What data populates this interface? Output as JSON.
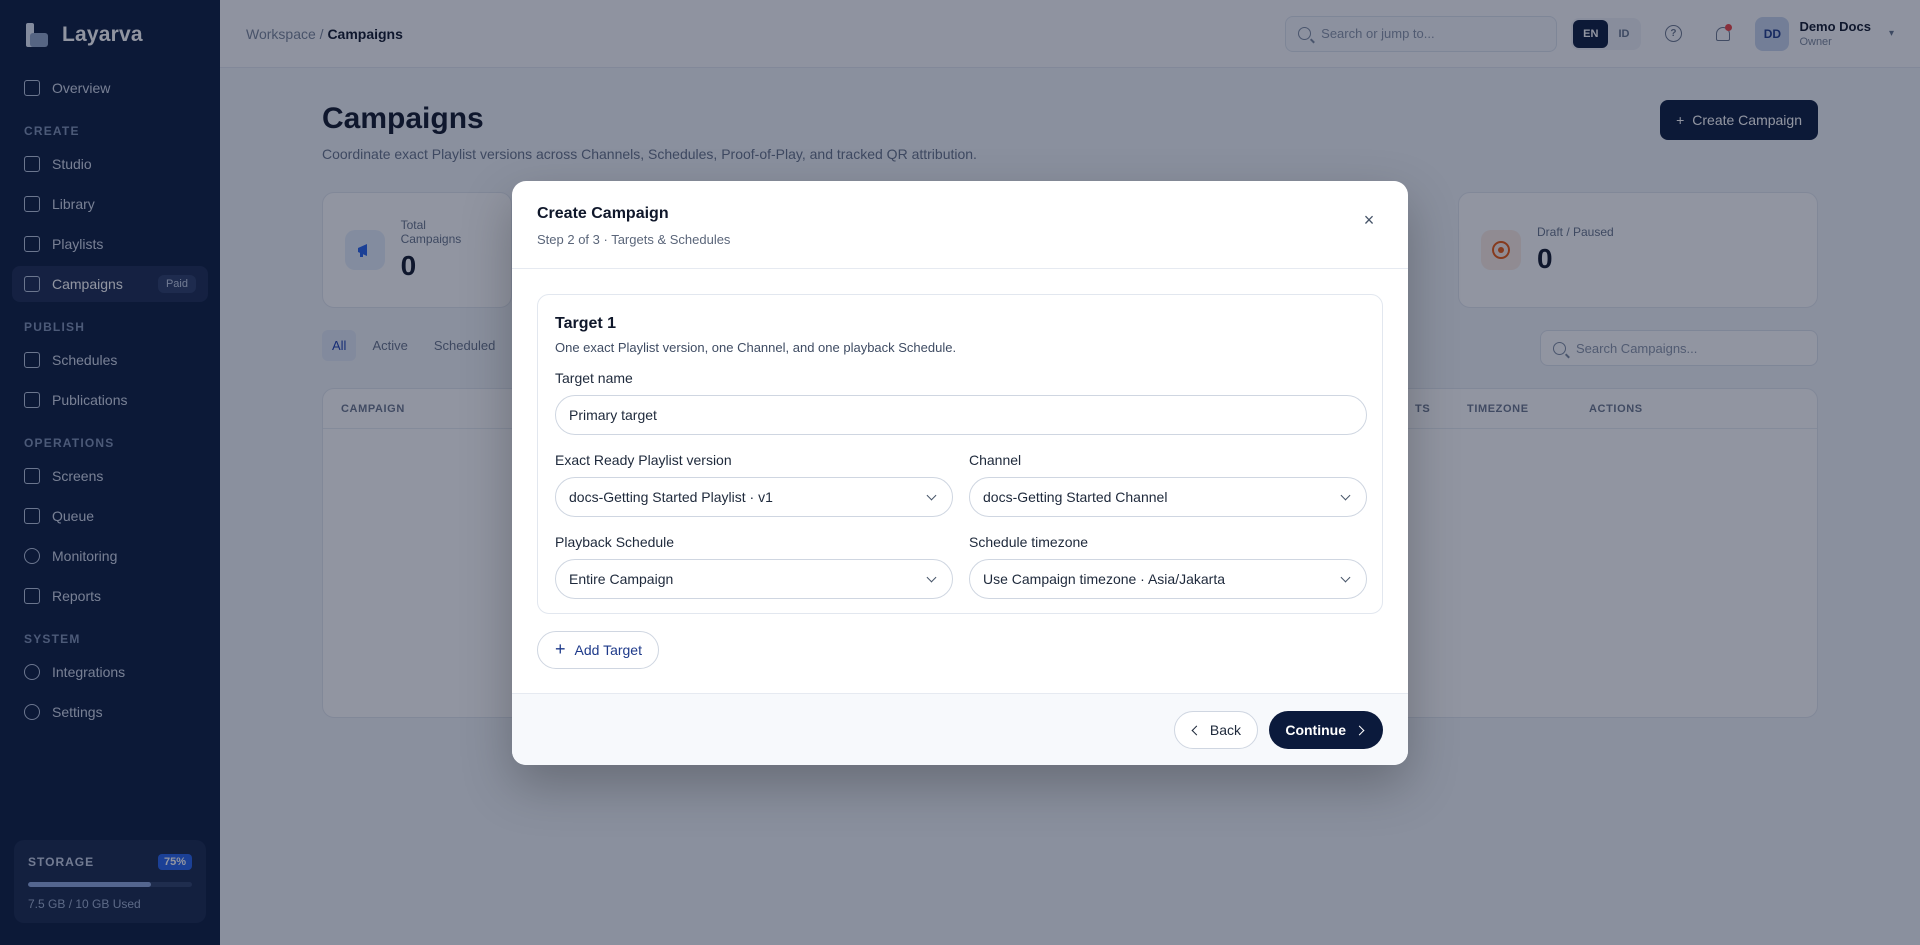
{
  "app": {
    "name": "Layarva"
  },
  "sidebar": {
    "top_item": {
      "label": "Overview",
      "icon": "grid-icon"
    },
    "sections": [
      {
        "title": "CREATE",
        "items": [
          {
            "label": "Studio",
            "icon": "monitor-icon"
          },
          {
            "label": "Library",
            "icon": "folder-icon"
          },
          {
            "label": "Playlists",
            "icon": "list-icon"
          },
          {
            "label": "Campaigns",
            "icon": "megaphone-icon",
            "badge": "Paid",
            "active": true
          }
        ]
      },
      {
        "title": "PUBLISH",
        "items": [
          {
            "label": "Schedules",
            "icon": "calendar-icon"
          },
          {
            "label": "Publications",
            "icon": "send-icon"
          }
        ]
      },
      {
        "title": "OPERATIONS",
        "items": [
          {
            "label": "Screens",
            "icon": "screen-icon"
          },
          {
            "label": "Queue",
            "icon": "queue-icon"
          },
          {
            "label": "Monitoring",
            "icon": "activity-icon"
          },
          {
            "label": "Reports",
            "icon": "report-icon"
          }
        ]
      },
      {
        "title": "SYSTEM",
        "items": [
          {
            "label": "Integrations",
            "icon": "plug-icon"
          },
          {
            "label": "Settings",
            "icon": "gear-icon"
          }
        ]
      }
    ],
    "storage": {
      "title": "STORAGE",
      "percent_label": "75%",
      "percent": 0.75,
      "used": "7.5 GB / 10 GB Used"
    }
  },
  "topbar": {
    "breadcrumb_parent": "Workspace /",
    "breadcrumb_current": "Campaigns",
    "search_placeholder": "Search or jump to...",
    "lang_en": "EN",
    "lang_id": "ID",
    "user_initials": "DD",
    "user_name": "Demo Docs",
    "user_role": "Owner"
  },
  "page": {
    "title": "Campaigns",
    "subtitle": "Coordinate exact Playlist versions across Channels, Schedules, Proof-of-Play, and tracked QR attribution.",
    "create_button": "Create Campaign",
    "stats": [
      {
        "label": "Total Campaigns",
        "value": "0",
        "color": "#2563eb"
      },
      {
        "label": "Draft / Paused",
        "value": "0",
        "color": "#ea580c"
      }
    ],
    "tabs": [
      "All",
      "Active",
      "Scheduled"
    ],
    "list_search_placeholder": "Search Campaigns...",
    "table_headers": [
      "CAMPAIGN",
      "TS",
      "TIMEZONE",
      "ACTIONS"
    ]
  },
  "modal": {
    "title": "Create Campaign",
    "step": "Step 2 of 3 · Targets & Schedules",
    "target": {
      "title": "Target 1",
      "description": "One exact Playlist version, one Channel, and one playback Schedule.",
      "name_label": "Target name",
      "name_value": "Primary target",
      "playlist_label": "Exact Ready Playlist version",
      "playlist_value": "docs-Getting Started Playlist · v1",
      "channel_label": "Channel",
      "channel_value": "docs-Getting Started Channel",
      "schedule_label": "Playback Schedule",
      "schedule_value": "Entire Campaign",
      "timezone_label": "Schedule timezone",
      "timezone_value": "Use Campaign timezone · Asia/Jakarta"
    },
    "add_target": "Add Target",
    "back": "Back",
    "continue": "Continue"
  },
  "colors": {
    "sidebar": "#0b1a3c",
    "accent": "#1e3a8a",
    "primary_button": "#0b1a3c"
  }
}
